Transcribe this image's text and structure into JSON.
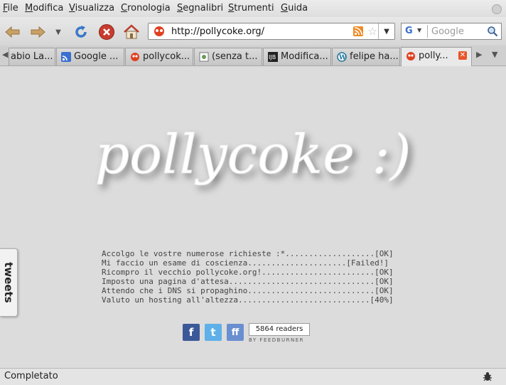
{
  "menu": {
    "items": [
      "File",
      "Modifica",
      "Visualizza",
      "Cronologia",
      "Segnalibri",
      "Strumenti",
      "Guida"
    ]
  },
  "toolbar": {
    "back_icon": "back-arrow-icon",
    "forward_icon": "forward-arrow-icon",
    "history_icon": "chevron-down-icon",
    "reload_icon": "reload-icon",
    "stop_icon": "stop-icon",
    "home_icon": "home-icon"
  },
  "address": {
    "url": "http://pollycoke.org/"
  },
  "search": {
    "placeholder": "Google",
    "engine_letter": "G"
  },
  "tabs": [
    {
      "label": "abio La...",
      "icon": "none"
    },
    {
      "label": "Google ...",
      "icon": "rss-icon"
    },
    {
      "label": "pollycok...",
      "icon": "pollycoke-icon"
    },
    {
      "label": "(senza t...",
      "icon": "generic-page-icon"
    },
    {
      "label": "Modifica...",
      "icon": "ijb-icon"
    },
    {
      "label": "felipe ha...",
      "icon": "wordpress-icon"
    },
    {
      "label": "polly...",
      "icon": "pollycoke-icon",
      "active": true
    }
  ],
  "page": {
    "logo_text": "pollycoke :)",
    "log_lines": [
      "Accolgo le vostre numerose richieste :*...................[OK]",
      "Mi faccio un esame di coscienza.....................[Failed!]",
      "Ricompro il vecchio pollycoke.org!........................[OK]",
      "Imposto una pagina d'attesa...............................[OK]",
      "Attendo che i DNS si propaghino...........................[OK]",
      "Valuto un hosting all'altezza............................[40%]"
    ],
    "feed_count": "5864 readers",
    "feed_by": "BY FEEDBURNER",
    "tweets_tab": "tweets"
  },
  "colors": {
    "facebook": "#3b5998",
    "twitter": "#5fb0e8",
    "friendfeed": "#6a8fd0",
    "accent": "#e8542a"
  },
  "status": {
    "text": "Completato"
  }
}
